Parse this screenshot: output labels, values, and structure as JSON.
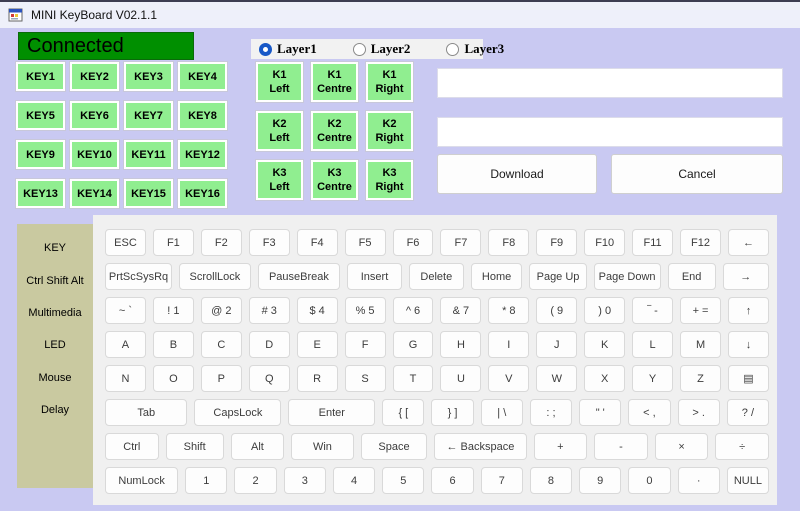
{
  "window": {
    "title": "MINI KeyBoard V02.1.1"
  },
  "status": {
    "connected_label": "Connected"
  },
  "layers": {
    "options": [
      {
        "label": "Layer1",
        "selected": true
      },
      {
        "label": "Layer2",
        "selected": false
      },
      {
        "label": "Layer3",
        "selected": false
      }
    ]
  },
  "key_grid": {
    "keys": [
      "KEY1",
      "KEY2",
      "KEY3",
      "KEY4",
      "KEY5",
      "KEY6",
      "KEY7",
      "KEY8",
      "KEY9",
      "KEY10",
      "KEY11",
      "KEY12",
      "KEY13",
      "KEY14",
      "KEY15",
      "KEY16"
    ]
  },
  "knob_grid": {
    "keys": [
      {
        "line1": "K1",
        "line2": "Left"
      },
      {
        "line1": "K1",
        "line2": "Centre"
      },
      {
        "line1": "K1",
        "line2": "Right"
      },
      {
        "line1": "K2",
        "line2": "Left"
      },
      {
        "line1": "K2",
        "line2": "Centre"
      },
      {
        "line1": "K2",
        "line2": "Right"
      },
      {
        "line1": "K3",
        "line2": "Left"
      },
      {
        "line1": "K3",
        "line2": "Centre"
      },
      {
        "line1": "K3",
        "line2": "Right"
      }
    ]
  },
  "inputs": {
    "field1": "",
    "field2": ""
  },
  "actions": {
    "download_label": "Download",
    "cancel_label": "Cancel"
  },
  "sidebar": {
    "tabs": [
      "KEY",
      "Ctrl Shift Alt",
      "Multimedia",
      "LED",
      "Mouse",
      "Delay"
    ]
  },
  "keyboard": {
    "rows": [
      [
        "ESC",
        "F1",
        "F2",
        "F3",
        "F4",
        "F5",
        "F6",
        "F7",
        "F8",
        "F9",
        "F10",
        "F11",
        "F12",
        "←"
      ],
      [
        "PrtScSysRq",
        "ScrollLock",
        "PauseBreak",
        "Insert",
        "Delete",
        "Home",
        "Page Up",
        "Page Down",
        "End",
        "→"
      ],
      [
        "~ `",
        "! 1",
        "@ 2",
        "# 3",
        "$ 4",
        "% 5",
        "^ 6",
        "& 7",
        "* 8",
        "( 9",
        ") 0",
        "‾ -",
        "+ =",
        "↑"
      ],
      [
        "A",
        "B",
        "C",
        "D",
        "E",
        "F",
        "G",
        "H",
        "I",
        "J",
        "K",
        "L",
        "M",
        "↓"
      ],
      [
        "N",
        "O",
        "P",
        "Q",
        "R",
        "S",
        "T",
        "U",
        "V",
        "W",
        "X",
        "Y",
        "Z",
        "▤"
      ],
      [
        "Tab",
        "CapsLock",
        "Enter",
        "{ [",
        "} ]",
        "| \\",
        ": ;",
        "\" '",
        "< ,",
        "> .",
        "? /"
      ],
      [
        "Ctrl",
        "Shift",
        "Alt",
        "Win",
        "Space",
        "← Backspace",
        "+",
        "-",
        "×",
        "÷"
      ],
      [
        "NumLock",
        "1",
        "2",
        "3",
        "4",
        "5",
        "6",
        "7",
        "8",
        "9",
        "0",
        "·",
        "NULL"
      ]
    ]
  },
  "colors": {
    "background": "#c9c9f2",
    "button_green": "#90ee90",
    "connected_green": "#008f00",
    "sidebar_tan": "#c9c9a0",
    "radio_blue": "#1758c7",
    "panel_gray": "#f0f0f0"
  }
}
